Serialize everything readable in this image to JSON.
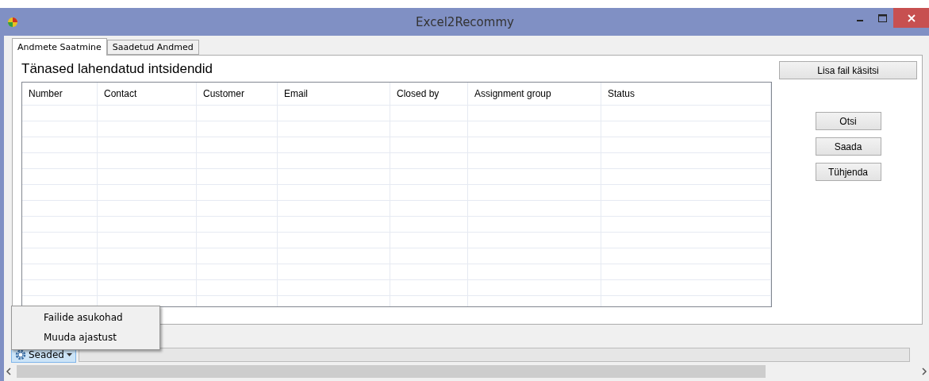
{
  "window": {
    "title": "Excel2Recommy"
  },
  "tabs": [
    {
      "label": "Andmete Saatmine",
      "selected": true
    },
    {
      "label": "Saadetud Andmed",
      "selected": false
    }
  ],
  "heading": "Tänased lahendatud intsidendid",
  "table": {
    "columns": [
      "Number",
      "Contact",
      "Customer",
      "Email",
      "Closed by",
      "Assignment group",
      "Status"
    ]
  },
  "buttons": {
    "add_file": "Lisa fail käsitsi",
    "actions": [
      "Otsi",
      "Saada",
      "Tühjenda"
    ]
  },
  "status_bar": {
    "settings": {
      "label": "Seaded",
      "expanded": true,
      "menu": [
        "Failide asukohad",
        "Muuda ajastust"
      ]
    }
  }
}
